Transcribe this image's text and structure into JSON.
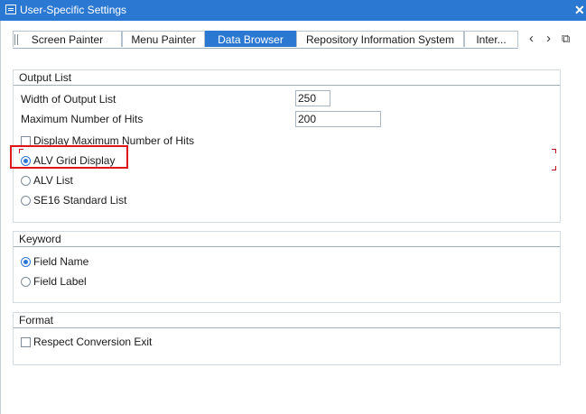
{
  "window": {
    "title": "User-Specific Settings",
    "close_glyph": "✕"
  },
  "tabs": [
    {
      "label": "Screen Painter",
      "active": false
    },
    {
      "label": "Menu Painter",
      "active": false
    },
    {
      "label": "Data Browser",
      "active": true
    },
    {
      "label": "Repository Information System",
      "active": false
    },
    {
      "label": "Inter...",
      "active": false
    }
  ],
  "tab_nav": {
    "prev": "‹",
    "next": "›",
    "menu": "⧉"
  },
  "output_list": {
    "header": "Output List",
    "width_label": "Width of Output List",
    "width_value": "250",
    "max_hits_label": "Maximum Number of Hits",
    "max_hits_value": "200",
    "display_max_label": "Display Maximum Number of Hits",
    "display_max_checked": false,
    "options": [
      {
        "label": "ALV Grid Display",
        "selected": true
      },
      {
        "label": "ALV List",
        "selected": false
      },
      {
        "label": "SE16 Standard List",
        "selected": false
      }
    ]
  },
  "keyword": {
    "header": "Keyword",
    "options": [
      {
        "label": "Field Name",
        "selected": true
      },
      {
        "label": "Field Label",
        "selected": false
      }
    ]
  },
  "format": {
    "header": "Format",
    "respect_conversion_label": "Respect Conversion Exit",
    "respect_conversion_checked": false
  },
  "colors": {
    "accent": "#2b78d3",
    "highlight": "#e0141c"
  }
}
